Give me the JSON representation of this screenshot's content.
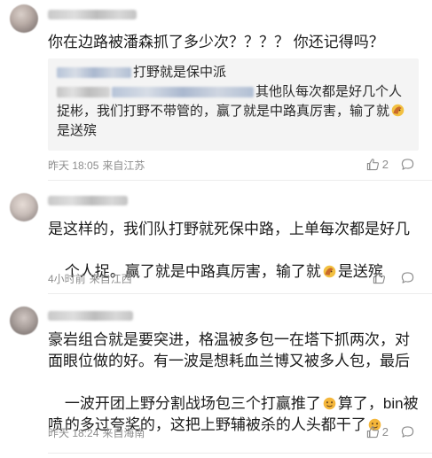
{
  "comments": [
    {
      "text_line1": "你在边路被潘森抓了多少次？？？？ 你还记得吗？",
      "quote": {
        "line1_visible": "打野就是保中派",
        "line2_visible": "其他队每次都是好几个人",
        "line3": "捉彬，我们打野不带管的，赢了就是中路真厉害，输了就",
        "line4": "是送殡"
      },
      "time": "昨天 18:05",
      "location": "来自江苏",
      "likes": "2"
    },
    {
      "text_line1": "是这样的，我们队打野就死保中路，上单每次都是好几",
      "text_line2_a": "个人捉。赢了就是中路真厉害，输了就",
      "text_line2_b": "是送殡",
      "time": "4小时前",
      "location": "来自江西",
      "likes": ""
    },
    {
      "text_line1": "豪岩组合就是要突进，格温被多包一在塔下抓两次，对",
      "text_line2": "面眼位做的好。有一波是想耗血兰博又被多人包，最后",
      "text_line3_a": "一波开团上野分割战场包三个打赢推了",
      "text_line3_b": "算了，bin被喷",
      "text_line4": "的多过夸奖的，这把上野辅被杀的人头都干了",
      "time": "昨天 18:24",
      "location": "来自海南",
      "likes": "2"
    }
  ],
  "icons": {
    "like": "thumbs-up-icon",
    "reply": "comment-bubble-icon",
    "emoji_hand": "face-palm-emoji",
    "emoji_face": "blushing-face-emoji"
  },
  "colors": {
    "meta_text": "#8d8d8d",
    "quote_bg": "#f4f4f4",
    "divider": "#ececec"
  }
}
